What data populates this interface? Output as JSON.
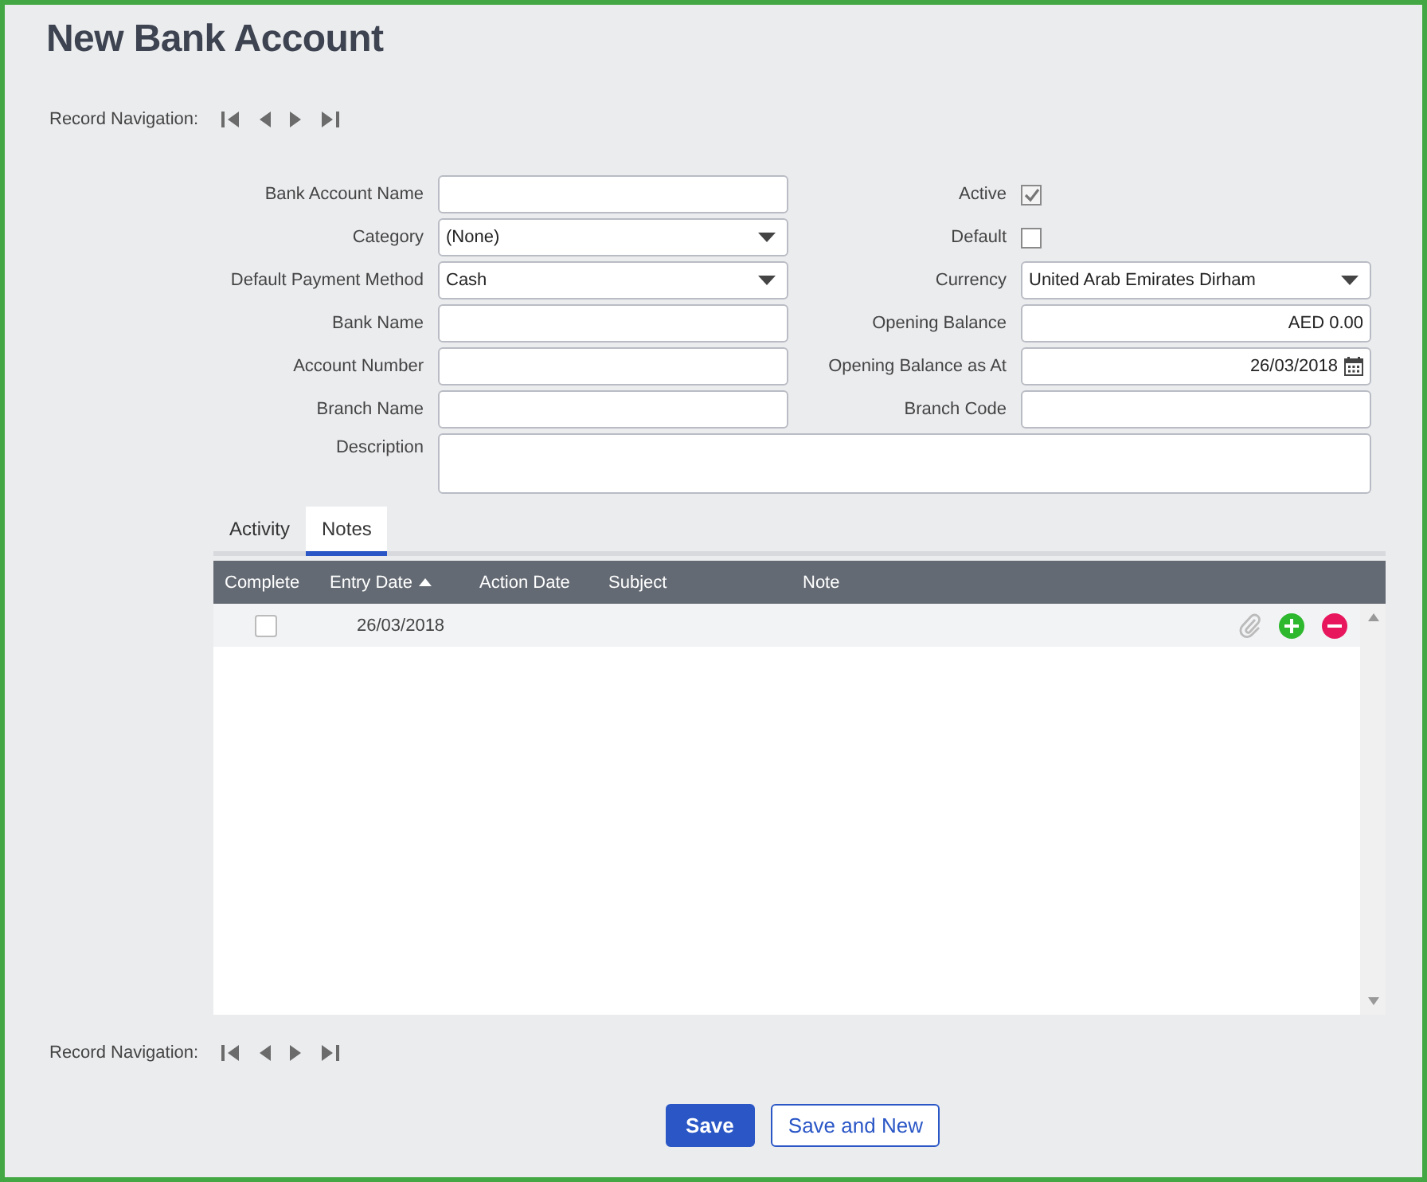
{
  "title": "New Bank Account",
  "record_navigation_top": {
    "label": "Record Navigation:"
  },
  "form": [
    {
      "label": "Bank Account Name",
      "kind": "text"
    },
    {
      "label": "Active",
      "kind": "checkbox",
      "checked": true
    },
    {
      "label": "Category",
      "kind": "select",
      "value": "(None)"
    },
    {
      "label": "Default",
      "kind": "checkbox",
      "checked": false
    },
    {
      "label": "Default Payment Method",
      "kind": "select",
      "value": "Cash"
    },
    {
      "label": "Currency",
      "kind": "select",
      "value": "United Arab Emirates Dirham"
    },
    {
      "label": "Bank Name",
      "kind": "text"
    },
    {
      "label": "Opening Balance",
      "kind": "number",
      "value": "AED 0.00"
    },
    {
      "label": "Account Number",
      "kind": "text"
    },
    {
      "label": "Opening Balance as At",
      "kind": "date",
      "value": "26/03/2018"
    },
    {
      "label": "Branch Name",
      "kind": "text"
    },
    {
      "label": "Branch Code",
      "kind": "text"
    },
    {
      "label": "Description",
      "kind": "textarea"
    }
  ],
  "tabs": [
    {
      "label": "Activity",
      "selected": false
    },
    {
      "label": "Notes",
      "selected": true
    }
  ],
  "table": {
    "columns": [
      {
        "label": "Complete",
        "sorted": false
      },
      {
        "label": "Entry Date",
        "sorted": true
      },
      {
        "label": "Action Date",
        "sorted": false
      },
      {
        "label": "Subject",
        "sorted": false
      },
      {
        "label": "Note",
        "sorted": false
      }
    ],
    "rows": [
      {
        "complete": false,
        "entry_date": "26/03/2018"
      }
    ]
  },
  "record_navigation_bottom": {
    "label": "Record Navigation:"
  },
  "buttons": [
    {
      "label": "Save",
      "kind": "primary"
    },
    {
      "label": "Save and New",
      "kind": "secondary"
    }
  ]
}
